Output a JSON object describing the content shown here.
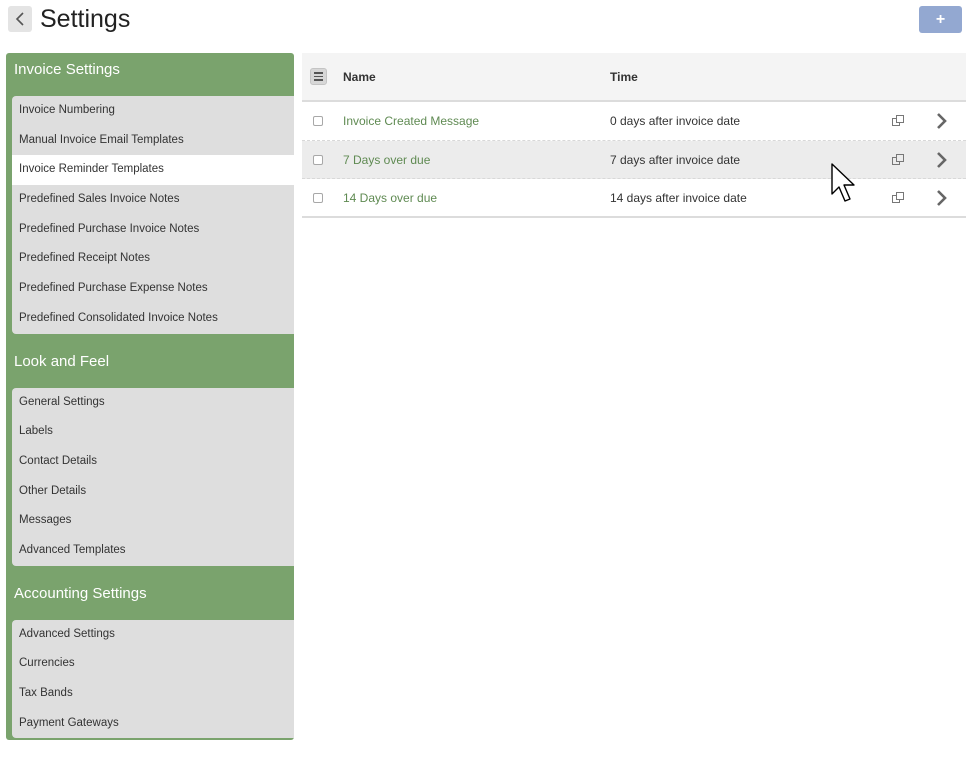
{
  "header": {
    "title": "Settings",
    "add_label": "+"
  },
  "sidebar": {
    "sections": [
      {
        "title": "Invoice Settings",
        "items": [
          "Invoice Numbering",
          "Manual Invoice Email Templates",
          "Invoice Reminder Templates",
          "Predefined Sales Invoice Notes",
          "Predefined Purchase Invoice Notes",
          "Predefined Receipt Notes",
          "Predefined Purchase Expense Notes",
          "Predefined Consolidated Invoice Notes"
        ]
      },
      {
        "title": "Look and Feel",
        "items": [
          "General Settings",
          "Labels",
          "Contact Details",
          "Other Details",
          "Messages",
          "Advanced Templates"
        ]
      },
      {
        "title": "Accounting Settings",
        "items": [
          "Advanced Settings",
          "Currencies",
          "Tax Bands",
          "Payment Gateways"
        ]
      }
    ],
    "active_item": "Invoice Reminder Templates"
  },
  "table": {
    "columns": {
      "name": "Name",
      "time": "Time"
    },
    "rows": [
      {
        "name": "Invoice Created Message",
        "time": "0 days after invoice date"
      },
      {
        "name": "7 Days over due",
        "time": "7 days after invoice date"
      },
      {
        "name": "14 Days over due",
        "time": "14 days after invoice date"
      }
    ]
  },
  "colors": {
    "sidebar_green": "#7aa36d",
    "link_green": "#5f8a52",
    "add_button_blue": "#93a8d1"
  },
  "icons": {
    "back": "chevron-left-icon",
    "add": "plus-icon",
    "menu": "list-menu-icon",
    "copy": "copy-icon",
    "row_open": "chevron-right-icon"
  }
}
